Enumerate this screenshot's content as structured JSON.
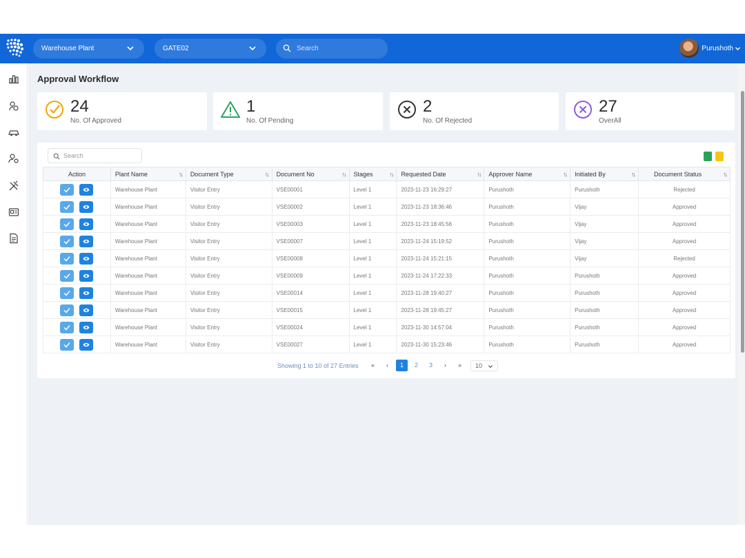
{
  "header": {
    "plant_select": "Warehouse Plant",
    "gate_select": "GATE02",
    "search_placeholder": "Search",
    "user_name": "Purushoth"
  },
  "page": {
    "title": "Approval Workflow"
  },
  "summary": [
    {
      "count": "24",
      "label": "No. Of Approved",
      "color": "#f0a500"
    },
    {
      "count": "1",
      "label": "No. Of Pending",
      "color": "#2aa35a"
    },
    {
      "count": "2",
      "label": "No. Of Rejected",
      "color": "#333333"
    },
    {
      "count": "27",
      "label": "OverAll",
      "color": "#8a5cd6"
    }
  ],
  "table": {
    "search_placeholder": "Search",
    "columns": [
      "Action",
      "Plant Name",
      "Document Type",
      "Document No",
      "Stages",
      "Requested Date",
      "Approver Name",
      "Initiated By",
      "Document Status"
    ],
    "rows": [
      [
        "Warehouse Plant",
        "Visitor Entry",
        "VSE00001",
        "Level 1",
        "2023-11-23 16:29:27",
        "Purushoth",
        "Purushoth",
        "Rejected"
      ],
      [
        "Warehouse Plant",
        "Visitor Entry",
        "VSE00002",
        "Level 1",
        "2023-11-23 18:36:46",
        "Purushoth",
        "Vijay",
        "Approved"
      ],
      [
        "Warehouse Plant",
        "Visitor Entry",
        "VSE00003",
        "Level 1",
        "2023-11-23 18:45:56",
        "Purushoth",
        "Vijay",
        "Approved"
      ],
      [
        "Warehouse Plant",
        "Visitor Entry",
        "VSE00007",
        "Level 1",
        "2023-11-24 15:19:52",
        "Purushoth",
        "Vijay",
        "Approved"
      ],
      [
        "Warehouse Plant",
        "Visitor Entry",
        "VSE00008",
        "Level 1",
        "2023-11-24 15:21:15",
        "Purushoth",
        "Vijay",
        "Rejected"
      ],
      [
        "Warehouse Plant",
        "Visitor Entry",
        "VSE00009",
        "Level 1",
        "2023-11-24 17:22:33",
        "Purushoth",
        "Purushoth",
        "Approved"
      ],
      [
        "Warehouse Plant",
        "Visitor Entry",
        "VSE00014",
        "Level 1",
        "2023-11-28 19:40:27",
        "Purushoth",
        "Purushoth",
        "Approved"
      ],
      [
        "Warehouse Plant",
        "Visitor Entry",
        "VSE00015",
        "Level 1",
        "2023-11-28 19:45:27",
        "Purushoth",
        "Purushoth",
        "Approved"
      ],
      [
        "Warehouse Plant",
        "Visitor Entry",
        "VSE00024",
        "Level 1",
        "2023-11-30 14:57:04",
        "Purushoth",
        "Purushoth",
        "Approved"
      ],
      [
        "Warehouse Plant",
        "Visitor Entry",
        "VSE00027",
        "Level 1",
        "2023-11-30 15:23:46",
        "Purushoth",
        "Purushoth",
        "Approved"
      ]
    ]
  },
  "pagination": {
    "info": "Showing 1 to 10 of 27 Entries",
    "first": "«",
    "prev": "‹",
    "pages": [
      "1",
      "2",
      "3"
    ],
    "next": "›",
    "last": "»",
    "per_page": "10"
  },
  "colors": {
    "primary": "#1167d8",
    "accent": "#1e83e0"
  }
}
